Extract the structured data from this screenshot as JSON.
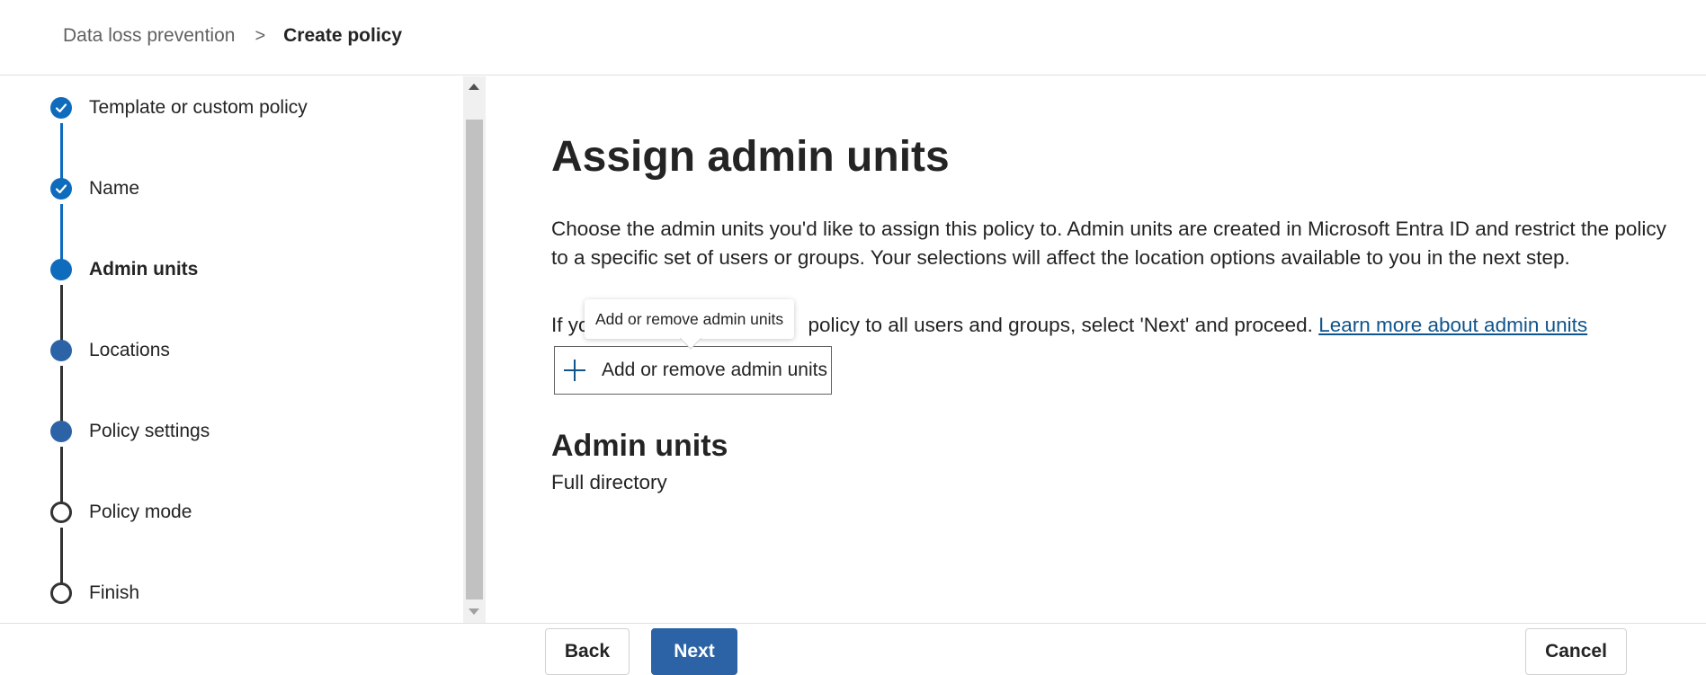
{
  "breadcrumb": {
    "parent": "Data loss prevention",
    "separator": ">",
    "current": "Create policy"
  },
  "steps": [
    {
      "label": "Template or custom policy",
      "state": "done"
    },
    {
      "label": "Name",
      "state": "done"
    },
    {
      "label": "Admin units",
      "state": "current"
    },
    {
      "label": "Locations",
      "state": "future"
    },
    {
      "label": "Policy settings",
      "state": "future"
    },
    {
      "label": "Policy mode",
      "state": "empty"
    },
    {
      "label": "Finish",
      "state": "empty"
    }
  ],
  "main": {
    "title": "Assign admin units",
    "description": "Choose the admin units you'd like to assign this policy to. Admin units are created in Microsoft Entra ID and restrict the policy to a specific set of users or groups. Your selections will affect the location options available to you in the next step.",
    "instruction_prefix": "If yo",
    "instruction_suffix": "policy to all users and groups, select 'Next' and proceed. ",
    "learn_more_link": "Learn more about admin units",
    "add_button_label": "Add or remove admin units",
    "tooltip_text": "Add or remove admin units",
    "section_title": "Admin units",
    "section_value": "Full directory"
  },
  "footer": {
    "back_label": "Back",
    "next_label": "Next",
    "cancel_label": "Cancel"
  },
  "colors": {
    "accent": "#0f6cbd",
    "primary_button": "#2b63a6",
    "link": "#0f548c"
  },
  "icons": {
    "completed_step": "checkmark-icon",
    "add": "plus-icon",
    "breadcrumb_separator": "chevron-right-icon"
  }
}
